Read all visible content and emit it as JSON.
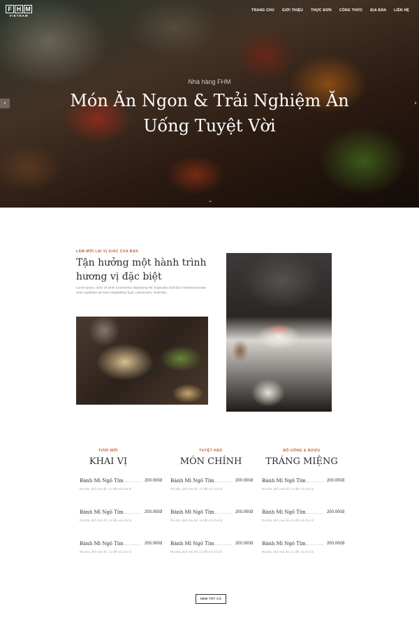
{
  "header": {
    "logo_letters": [
      "F",
      "H",
      "M"
    ],
    "logo_sub": "VIETNAM",
    "nav": [
      "TRANG CHỦ",
      "GIỚI THIỆU",
      "THỰC ĐƠN",
      "CÔNG THỨC",
      "ĐỊA BÀN",
      "LIÊN HỆ"
    ]
  },
  "hero": {
    "subtitle": "Nhà hàng FHM",
    "title": "Món Ăn Ngon & Trải Nghiệm Ăn Uống Tuyệt Vời",
    "arrow_left": "‹",
    "arrow_right": "›",
    "arrow_down": "⌄"
  },
  "about": {
    "kicker": "LÀM MỚI LẠI VỊ GIÁC CỦA BẠN",
    "title": "Tận hưởng một hành trình hương vị đặc biệt",
    "text": "Lorem ipsum, dolor sit amet consectetur adipisicing elit. Explicabo doloribus molestias beatae vitae cupiditate ad esse voluptatibus fugit. Laboriosam, molestias."
  },
  "menu": {
    "columns": [
      {
        "kicker": "TƯƠI MỚI",
        "title": "KHAI VỊ",
        "items": [
          {
            "name": "Bánh Mì Ngô Tím",
            "price": "200.000đ",
            "desc": "Ricotta, phô mai dê, củ dền và cha là"
          },
          {
            "name": "Bánh Mì Ngô Tím",
            "price": "200.000đ",
            "desc": "Ricotta, phô mai dê, củ dền và cha là"
          },
          {
            "name": "Bánh Mì Ngô Tím",
            "price": "200.000đ",
            "desc": "Ricotta, phô mai dê, củ dền và cha là"
          }
        ]
      },
      {
        "kicker": "TUYỆT HẢO",
        "title": "MÓN CHÍNH",
        "items": [
          {
            "name": "Bánh Mì Ngô Tím",
            "price": "200.000đ",
            "desc": "Ricotta, phô mai dê, củ dền và cha là"
          },
          {
            "name": "Bánh Mì Ngô Tím",
            "price": "200.000đ",
            "desc": "Ricotta, phô mai dê, củ dền và cha là"
          },
          {
            "name": "Bánh Mì Ngô Tím",
            "price": "200.000đ",
            "desc": "Ricotta, phô mai dê, củ dền và cha là"
          }
        ]
      },
      {
        "kicker": "ĐỒ UỐNG & RƯỢU",
        "title": "TRÁNG MIỆNG",
        "items": [
          {
            "name": "Bánh Mì Ngô Tím",
            "price": "200.000đ",
            "desc": "Ricotta, phô mai dê, củ dền và cha là"
          },
          {
            "name": "Bánh Mì Ngô Tím",
            "price": "200.000đ",
            "desc": "Ricotta, phô mai dê, củ dền và cha là"
          },
          {
            "name": "Bánh Mì Ngô Tím",
            "price": "200.000đ",
            "desc": "Ricotta, phô mai dê, củ dền và cha là"
          }
        ]
      }
    ],
    "view_all": "XEM TẤT CẢ"
  },
  "colors": {
    "accent": "#c0592e",
    "text_dark": "#2b2b2b",
    "text_muted": "#888888"
  }
}
